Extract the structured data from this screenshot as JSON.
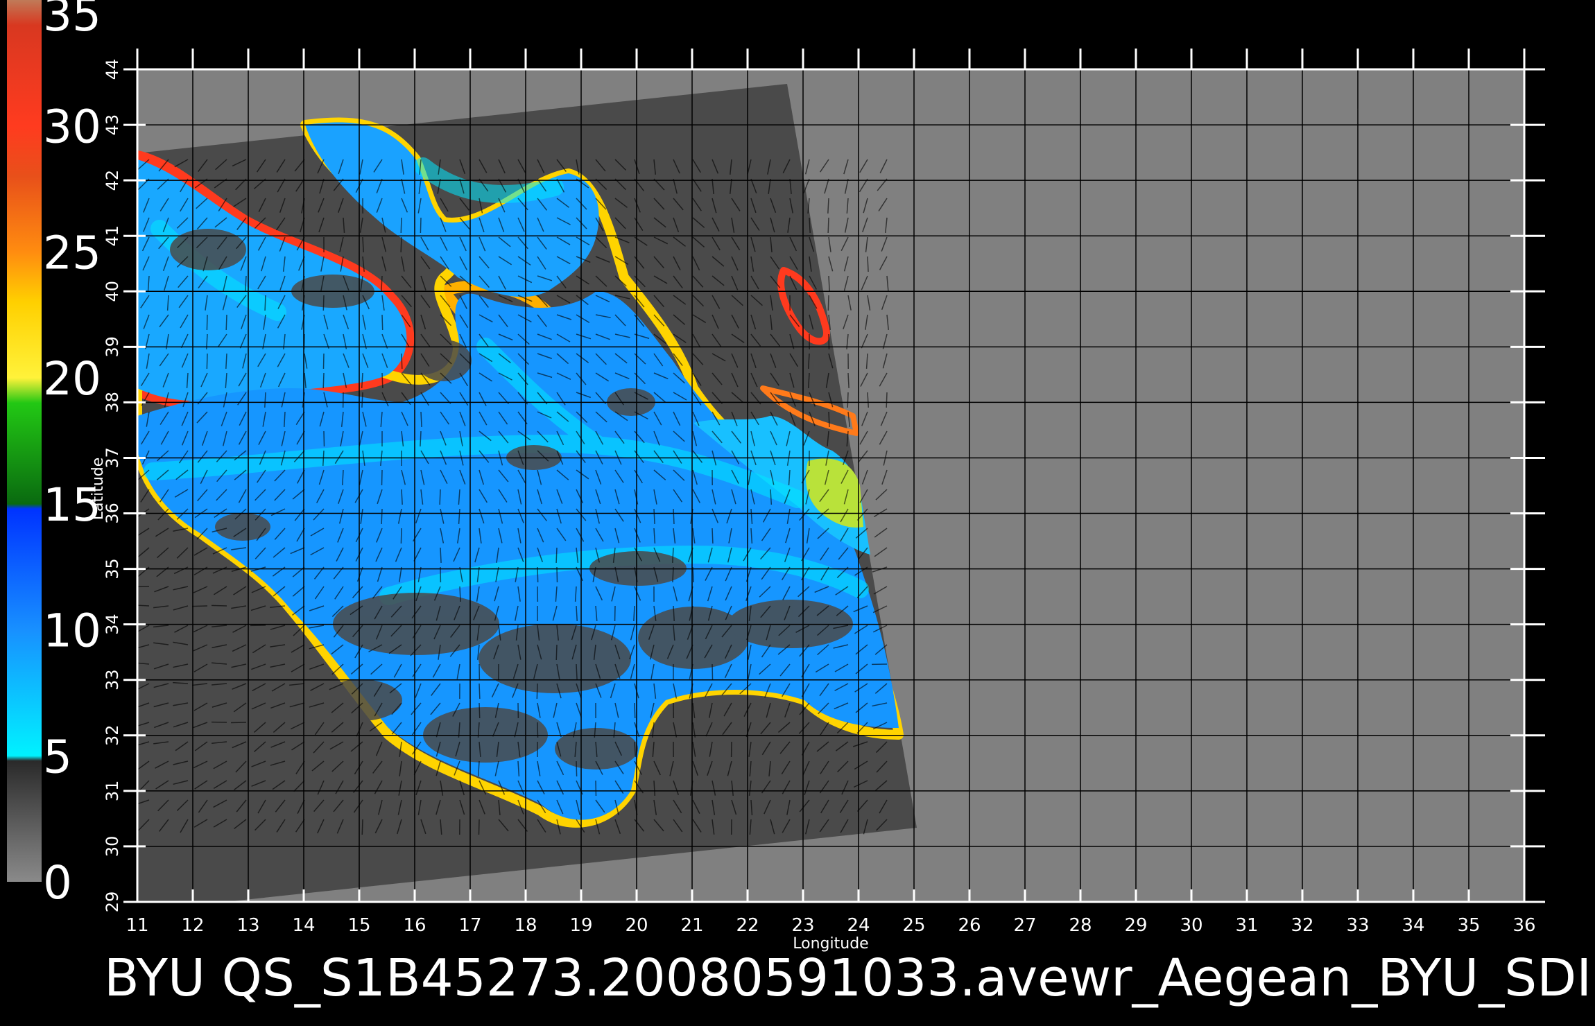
{
  "colorbar": {
    "labels": [
      "35",
      "30",
      "25",
      "20",
      "15",
      "10",
      "5",
      "0"
    ],
    "values": [
      35,
      30,
      25,
      20,
      15,
      10,
      5,
      0
    ],
    "stops": [
      {
        "value": 35,
        "color": "#c07a58"
      },
      {
        "value": 34,
        "color": "#d83820"
      },
      {
        "value": 30,
        "color": "#ff3b1f"
      },
      {
        "value": 28,
        "color": "#e8501a"
      },
      {
        "value": 25,
        "color": "#ff8c10"
      },
      {
        "value": 23,
        "color": "#ffd000"
      },
      {
        "value": 20,
        "color": "#fff23a"
      },
      {
        "value": 19,
        "color": "#22c814"
      },
      {
        "value": 15,
        "color": "#0a6a10"
      },
      {
        "value": 14.8,
        "color": "#0033ff"
      },
      {
        "value": 10,
        "color": "#1890ff"
      },
      {
        "value": 5,
        "color": "#00f2ff"
      },
      {
        "value": 4.8,
        "color": "#2a2a2a"
      },
      {
        "value": 0,
        "color": "#8a8a8a"
      }
    ]
  },
  "map": {
    "lon_range": [
      11,
      36
    ],
    "lat_range": [
      29,
      44
    ],
    "x_ticks": [
      "11",
      "12",
      "13",
      "14",
      "15",
      "16",
      "17",
      "18",
      "19",
      "20",
      "21",
      "22",
      "23",
      "24",
      "25",
      "26",
      "27",
      "28",
      "29",
      "30",
      "31",
      "32",
      "33",
      "34",
      "35",
      "36"
    ],
    "y_ticks": [
      "29",
      "30",
      "31",
      "32",
      "33",
      "34",
      "35",
      "36",
      "37",
      "38",
      "39",
      "40",
      "41",
      "42",
      "43",
      "44"
    ],
    "xlabel": "Longitude",
    "ylabel": "Latitude",
    "grid": true,
    "colors": {
      "background": "#808080",
      "swath": "#4a4a4a",
      "wind_low": "#00e5ff",
      "wind_mid": "#1a8cff",
      "coast_high": "#ff3a1e",
      "coast_mid": "#ffd400",
      "grid_line": "#000000",
      "axis": "#ffffff"
    }
  },
  "caption": "BYU  QS_S1B45273.20080591033.avewr_Aegean_BYU_SDI"
}
